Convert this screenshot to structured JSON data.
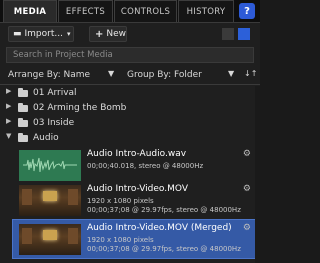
{
  "tabs": [
    {
      "label": "MEDIA"
    },
    {
      "label": "EFFECTS"
    },
    {
      "label": "CONTROLS"
    },
    {
      "label": "HISTORY"
    }
  ],
  "help_label": "?",
  "toolbar": {
    "import_label": "Import...",
    "new_label": "New"
  },
  "search": {
    "placeholder": "Search in Project Media"
  },
  "arrange": {
    "arrange_label": "Arrange By: Name",
    "group_label": "Group By: Folder"
  },
  "folders": [
    {
      "name": "01 Arrival"
    },
    {
      "name": "02 Arming the Bomb"
    },
    {
      "name": "03 Inside"
    },
    {
      "name": "Audio"
    }
  ],
  "media_items": [
    {
      "title": "Audio Intro-Audio.wav",
      "line1": "00;00;40.018, stereo @ 48000Hz",
      "line2": ""
    },
    {
      "title": "Audio Intro-Video.MOV",
      "line1": "1920 x 1080 pixels",
      "line2": "00;00;37;08 @ 29.97fps, stereo @ 48000Hz"
    },
    {
      "title": "Audio Intro-Video.MOV (Merged)",
      "line1": "1920 x 1080 pixels",
      "line2": "00;00;37;08 @ 29.97fps, stereo @ 48000Hz"
    }
  ],
  "colors": {
    "accent": "#2c60d9",
    "selected_row": "#355aa6"
  }
}
